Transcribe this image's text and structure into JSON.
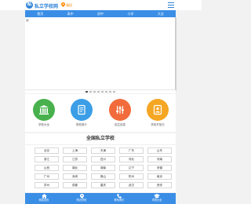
{
  "header": {
    "logo_char": "私",
    "site_name": "私立学校网",
    "location": "福田"
  },
  "nav": [
    "首页",
    "高中",
    "初中",
    "小学",
    "大全"
  ],
  "banner": {
    "image_icon": "▦"
  },
  "dots_count": 8,
  "quick_links": [
    {
      "label": "学校大全",
      "color": "#48b14d",
      "icon": "school-building-icon"
    },
    {
      "label": "院校简介",
      "color": "#3b9ee6",
      "icon": "document-icon"
    },
    {
      "label": "招生信息",
      "color": "#f26b3a",
      "icon": "sliders-icon"
    },
    {
      "label": "学校开放日",
      "color": "#f5a623",
      "icon": "id-card-icon"
    }
  ],
  "section_title": "全国私立学校",
  "cities": [
    [
      "北京",
      "上海",
      "天津",
      "广东",
      "山东"
    ],
    [
      "浙江",
      "江苏",
      "四川",
      "河北",
      "河南"
    ],
    [
      "山西",
      "湖北",
      "湖南",
      "辽宁",
      "安徽"
    ],
    [
      "广州",
      "深圳",
      "佛山",
      "杭州",
      "南京"
    ],
    [
      "苏州",
      "成都",
      "重庆",
      "武汉",
      "西安"
    ]
  ],
  "bottom_bar": [
    {
      "label": "网站首页",
      "icon": "home-icon"
    },
    {
      "label": "附近学校",
      "icon": "location-icon"
    },
    {
      "label": "联系我们",
      "icon": "phone-icon"
    },
    {
      "label": "学校大全",
      "icon": "graduation-cap-icon"
    }
  ]
}
